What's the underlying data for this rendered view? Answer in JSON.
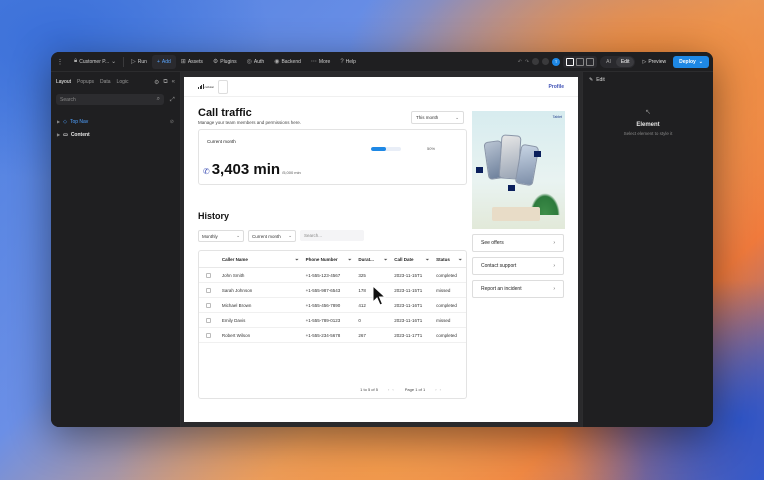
{
  "topbar": {
    "project": "Customer P...",
    "run": "Run",
    "add": "Add",
    "assets": "Assets",
    "plugins": "Plugins",
    "auth": "Auth",
    "backend": "Backend",
    "more": "More",
    "help": "Help",
    "avatar_initial": "T",
    "mode_ai": "AI",
    "mode_edit": "Edit",
    "preview": "Preview",
    "deploy": "Deploy"
  },
  "left": {
    "tabs": [
      "Layout",
      "Popups",
      "Data",
      "Logic"
    ],
    "search_placeholder": "Search",
    "tree": [
      "Top Nav",
      "Content"
    ]
  },
  "right": {
    "header": "Edit",
    "empty_title": "Element",
    "empty_sub": "Select element to style it"
  },
  "page": {
    "nav": {
      "logo": "cellular",
      "profile": "Profile"
    },
    "title": "Call traffic",
    "subtitle": "Manage your team members and permissions here.",
    "period": "This month",
    "card": {
      "label": "Current month",
      "value": "3,403 min",
      "of": "/5,000 min",
      "percent_text": "50%",
      "progress": 0.5
    },
    "history_title": "History",
    "filters": {
      "interval": "Monthly",
      "month": "Current month",
      "search_placeholder": "Search..."
    },
    "table": {
      "headers": [
        "Caller Name",
        "Phone Number",
        "Durat...",
        "Call Date",
        "Status"
      ],
      "rows": [
        [
          "John Smith",
          "+1-555-123-4567",
          "325",
          "2023-11-15T1",
          "completed"
        ],
        [
          "Sarah Johnson",
          "+1-555-987-6543",
          "178",
          "2023-11-15T1",
          "missed"
        ],
        [
          "Michael Brown",
          "+1-555-456-7890",
          "412",
          "2023-11-16T1",
          "completed"
        ],
        [
          "Emily Davis",
          "+1-555-789-0123",
          "0",
          "2023-11-16T1",
          "missed"
        ],
        [
          "Robert Wilson",
          "+1-555-234-5678",
          "267",
          "2023-11-17T1",
          "completed"
        ]
      ],
      "range": "1 to 5 of 5",
      "page": "Page 1 of 1"
    },
    "side": {
      "corner": "Tablet",
      "buttons": [
        "See offers",
        "Contact support",
        "Report an incident"
      ]
    }
  },
  "colors": {
    "accent": "#1e88e5",
    "link": "#3f51b5"
  }
}
